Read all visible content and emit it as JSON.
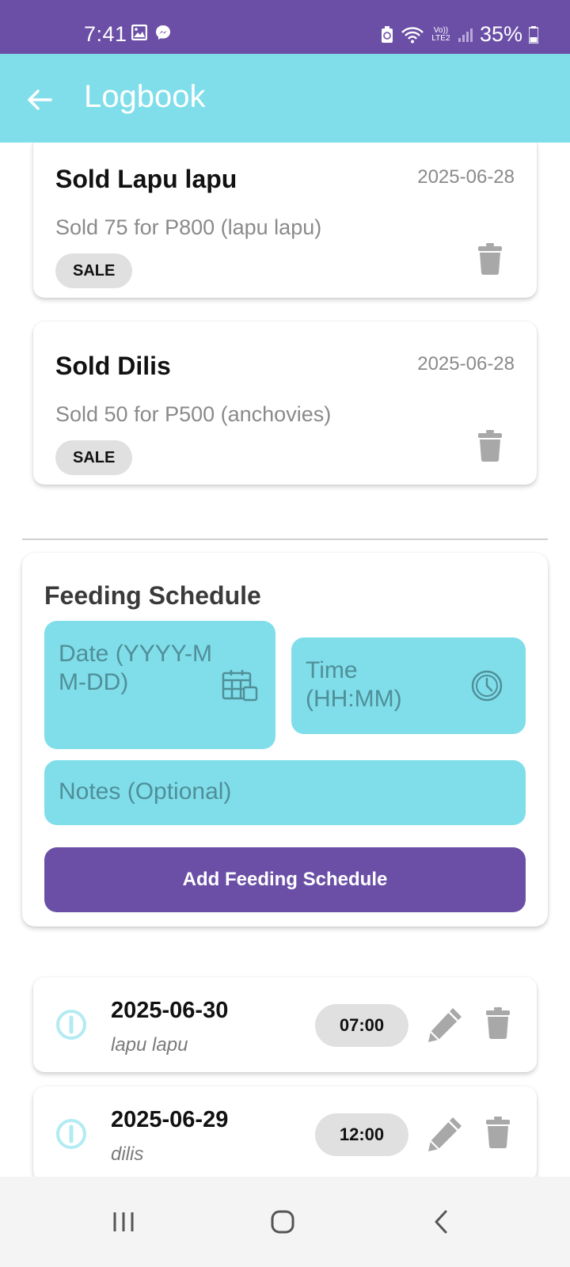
{
  "status_bar": {
    "time": "7:41",
    "battery": "35%",
    "network_label": "Vo)) LTE2",
    "icons": [
      "gallery-icon",
      "messenger-icon",
      "battery-saver-icon",
      "wifi-icon",
      "signal-icon",
      "battery-icon"
    ]
  },
  "app_bar": {
    "title": "Logbook",
    "back_icon": "arrow-left-icon",
    "background_color": "#80deea"
  },
  "logs": [
    {
      "title": "Sold Lapu lapu",
      "date": "2025-06-28",
      "description": "Sold 75 for P800 (lapu lapu)",
      "badge": "SALE"
    },
    {
      "title": "Sold Dilis",
      "date": "2025-06-28",
      "description": "Sold 50 for P500 (anchovies)",
      "badge": "SALE"
    }
  ],
  "feeding": {
    "title": "Feeding Schedule",
    "date_placeholder": "Date (YYYY-MM-DD)",
    "time_placeholder": "Time (HH:MM)",
    "notes_placeholder": "Notes (Optional)",
    "add_button_label": "Add Feeding Schedule",
    "accent_color": "#6b4fa6"
  },
  "schedules": [
    {
      "date": "2025-06-30",
      "note": "lapu lapu",
      "time": "07:00"
    },
    {
      "date": "2025-06-29",
      "note": "dilis",
      "time": "12:00"
    }
  ]
}
